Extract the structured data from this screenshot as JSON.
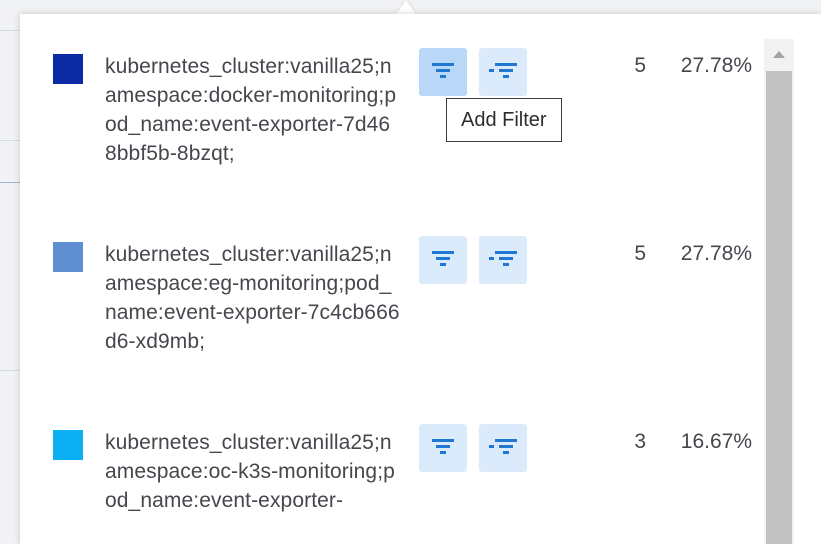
{
  "legend": {
    "items": [
      {
        "color": "#0b2aa3",
        "label": "kubernetes_cluster:vanilla25;namespace:docker-monitoring;pod_name:event-exporter-7d468bbf5b-8bzqt;",
        "count": "5",
        "percent": "27.78%"
      },
      {
        "color": "#5f8fd2",
        "label": "kubernetes_cluster:vanilla25;namespace:eg-monitoring;pod_name:event-exporter-7c4cb666d6-xd9mb;",
        "count": "5",
        "percent": "27.78%"
      },
      {
        "color": "#0aaff4",
        "label": "kubernetes_cluster:vanilla25;namespace:oc-k3s-monitoring;pod_name:event-exporter-",
        "count": "3",
        "percent": "16.67%"
      }
    ],
    "add_filter_icon": "filter-icon",
    "exclude_filter_icon": "exclude-filter-icon",
    "accent_color": "#1f78d1"
  },
  "tooltip": {
    "text": "Add Filter"
  },
  "scrollbar": {
    "up_icon": "arrow-up-icon"
  }
}
